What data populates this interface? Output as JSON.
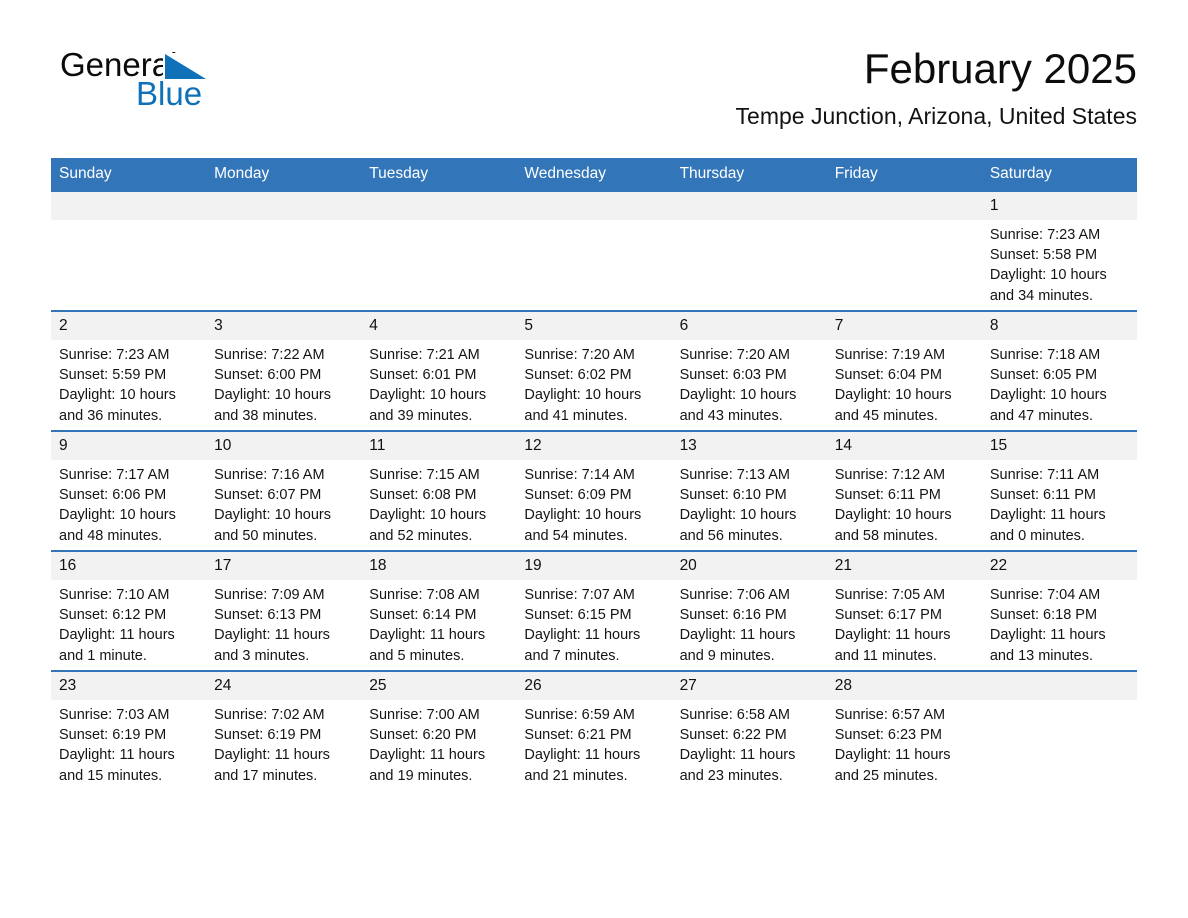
{
  "brand": {
    "name_part1": "General",
    "name_part2": "Blue",
    "logo_icon": "blue-triangle-icon",
    "color_primary": "#0b0b0b",
    "color_accent": "#1071b9"
  },
  "header": {
    "month_title": "February 2025",
    "location": "Tempe Junction, Arizona, United States"
  },
  "theme": {
    "header_blue": "#3275b8",
    "daynum_band": "#f2f2f2",
    "text": "#141414"
  },
  "weekdays": [
    "Sunday",
    "Monday",
    "Tuesday",
    "Wednesday",
    "Thursday",
    "Friday",
    "Saturday"
  ],
  "weeks": [
    [
      {
        "day": "",
        "blank": true
      },
      {
        "day": "",
        "blank": true
      },
      {
        "day": "",
        "blank": true
      },
      {
        "day": "",
        "blank": true
      },
      {
        "day": "",
        "blank": true
      },
      {
        "day": "",
        "blank": true
      },
      {
        "day": "1",
        "sunrise": "Sunrise: 7:23 AM",
        "sunset": "Sunset: 5:58 PM",
        "daylight": "Daylight: 10 hours and 34 minutes."
      }
    ],
    [
      {
        "day": "2",
        "sunrise": "Sunrise: 7:23 AM",
        "sunset": "Sunset: 5:59 PM",
        "daylight": "Daylight: 10 hours and 36 minutes."
      },
      {
        "day": "3",
        "sunrise": "Sunrise: 7:22 AM",
        "sunset": "Sunset: 6:00 PM",
        "daylight": "Daylight: 10 hours and 38 minutes."
      },
      {
        "day": "4",
        "sunrise": "Sunrise: 7:21 AM",
        "sunset": "Sunset: 6:01 PM",
        "daylight": "Daylight: 10 hours and 39 minutes."
      },
      {
        "day": "5",
        "sunrise": "Sunrise: 7:20 AM",
        "sunset": "Sunset: 6:02 PM",
        "daylight": "Daylight: 10 hours and 41 minutes."
      },
      {
        "day": "6",
        "sunrise": "Sunrise: 7:20 AM",
        "sunset": "Sunset: 6:03 PM",
        "daylight": "Daylight: 10 hours and 43 minutes."
      },
      {
        "day": "7",
        "sunrise": "Sunrise: 7:19 AM",
        "sunset": "Sunset: 6:04 PM",
        "daylight": "Daylight: 10 hours and 45 minutes."
      },
      {
        "day": "8",
        "sunrise": "Sunrise: 7:18 AM",
        "sunset": "Sunset: 6:05 PM",
        "daylight": "Daylight: 10 hours and 47 minutes."
      }
    ],
    [
      {
        "day": "9",
        "sunrise": "Sunrise: 7:17 AM",
        "sunset": "Sunset: 6:06 PM",
        "daylight": "Daylight: 10 hours and 48 minutes."
      },
      {
        "day": "10",
        "sunrise": "Sunrise: 7:16 AM",
        "sunset": "Sunset: 6:07 PM",
        "daylight": "Daylight: 10 hours and 50 minutes."
      },
      {
        "day": "11",
        "sunrise": "Sunrise: 7:15 AM",
        "sunset": "Sunset: 6:08 PM",
        "daylight": "Daylight: 10 hours and 52 minutes."
      },
      {
        "day": "12",
        "sunrise": "Sunrise: 7:14 AM",
        "sunset": "Sunset: 6:09 PM",
        "daylight": "Daylight: 10 hours and 54 minutes."
      },
      {
        "day": "13",
        "sunrise": "Sunrise: 7:13 AM",
        "sunset": "Sunset: 6:10 PM",
        "daylight": "Daylight: 10 hours and 56 minutes."
      },
      {
        "day": "14",
        "sunrise": "Sunrise: 7:12 AM",
        "sunset": "Sunset: 6:11 PM",
        "daylight": "Daylight: 10 hours and 58 minutes."
      },
      {
        "day": "15",
        "sunrise": "Sunrise: 7:11 AM",
        "sunset": "Sunset: 6:11 PM",
        "daylight": "Daylight: 11 hours and 0 minutes."
      }
    ],
    [
      {
        "day": "16",
        "sunrise": "Sunrise: 7:10 AM",
        "sunset": "Sunset: 6:12 PM",
        "daylight": "Daylight: 11 hours and 1 minute."
      },
      {
        "day": "17",
        "sunrise": "Sunrise: 7:09 AM",
        "sunset": "Sunset: 6:13 PM",
        "daylight": "Daylight: 11 hours and 3 minutes."
      },
      {
        "day": "18",
        "sunrise": "Sunrise: 7:08 AM",
        "sunset": "Sunset: 6:14 PM",
        "daylight": "Daylight: 11 hours and 5 minutes."
      },
      {
        "day": "19",
        "sunrise": "Sunrise: 7:07 AM",
        "sunset": "Sunset: 6:15 PM",
        "daylight": "Daylight: 11 hours and 7 minutes."
      },
      {
        "day": "20",
        "sunrise": "Sunrise: 7:06 AM",
        "sunset": "Sunset: 6:16 PM",
        "daylight": "Daylight: 11 hours and 9 minutes."
      },
      {
        "day": "21",
        "sunrise": "Sunrise: 7:05 AM",
        "sunset": "Sunset: 6:17 PM",
        "daylight": "Daylight: 11 hours and 11 minutes."
      },
      {
        "day": "22",
        "sunrise": "Sunrise: 7:04 AM",
        "sunset": "Sunset: 6:18 PM",
        "daylight": "Daylight: 11 hours and 13 minutes."
      }
    ],
    [
      {
        "day": "23",
        "sunrise": "Sunrise: 7:03 AM",
        "sunset": "Sunset: 6:19 PM",
        "daylight": "Daylight: 11 hours and 15 minutes."
      },
      {
        "day": "24",
        "sunrise": "Sunrise: 7:02 AM",
        "sunset": "Sunset: 6:19 PM",
        "daylight": "Daylight: 11 hours and 17 minutes."
      },
      {
        "day": "25",
        "sunrise": "Sunrise: 7:00 AM",
        "sunset": "Sunset: 6:20 PM",
        "daylight": "Daylight: 11 hours and 19 minutes."
      },
      {
        "day": "26",
        "sunrise": "Sunrise: 6:59 AM",
        "sunset": "Sunset: 6:21 PM",
        "daylight": "Daylight: 11 hours and 21 minutes."
      },
      {
        "day": "27",
        "sunrise": "Sunrise: 6:58 AM",
        "sunset": "Sunset: 6:22 PM",
        "daylight": "Daylight: 11 hours and 23 minutes."
      },
      {
        "day": "28",
        "sunrise": "Sunrise: 6:57 AM",
        "sunset": "Sunset: 6:23 PM",
        "daylight": "Daylight: 11 hours and 25 minutes."
      },
      {
        "day": "",
        "blank": true
      }
    ]
  ]
}
